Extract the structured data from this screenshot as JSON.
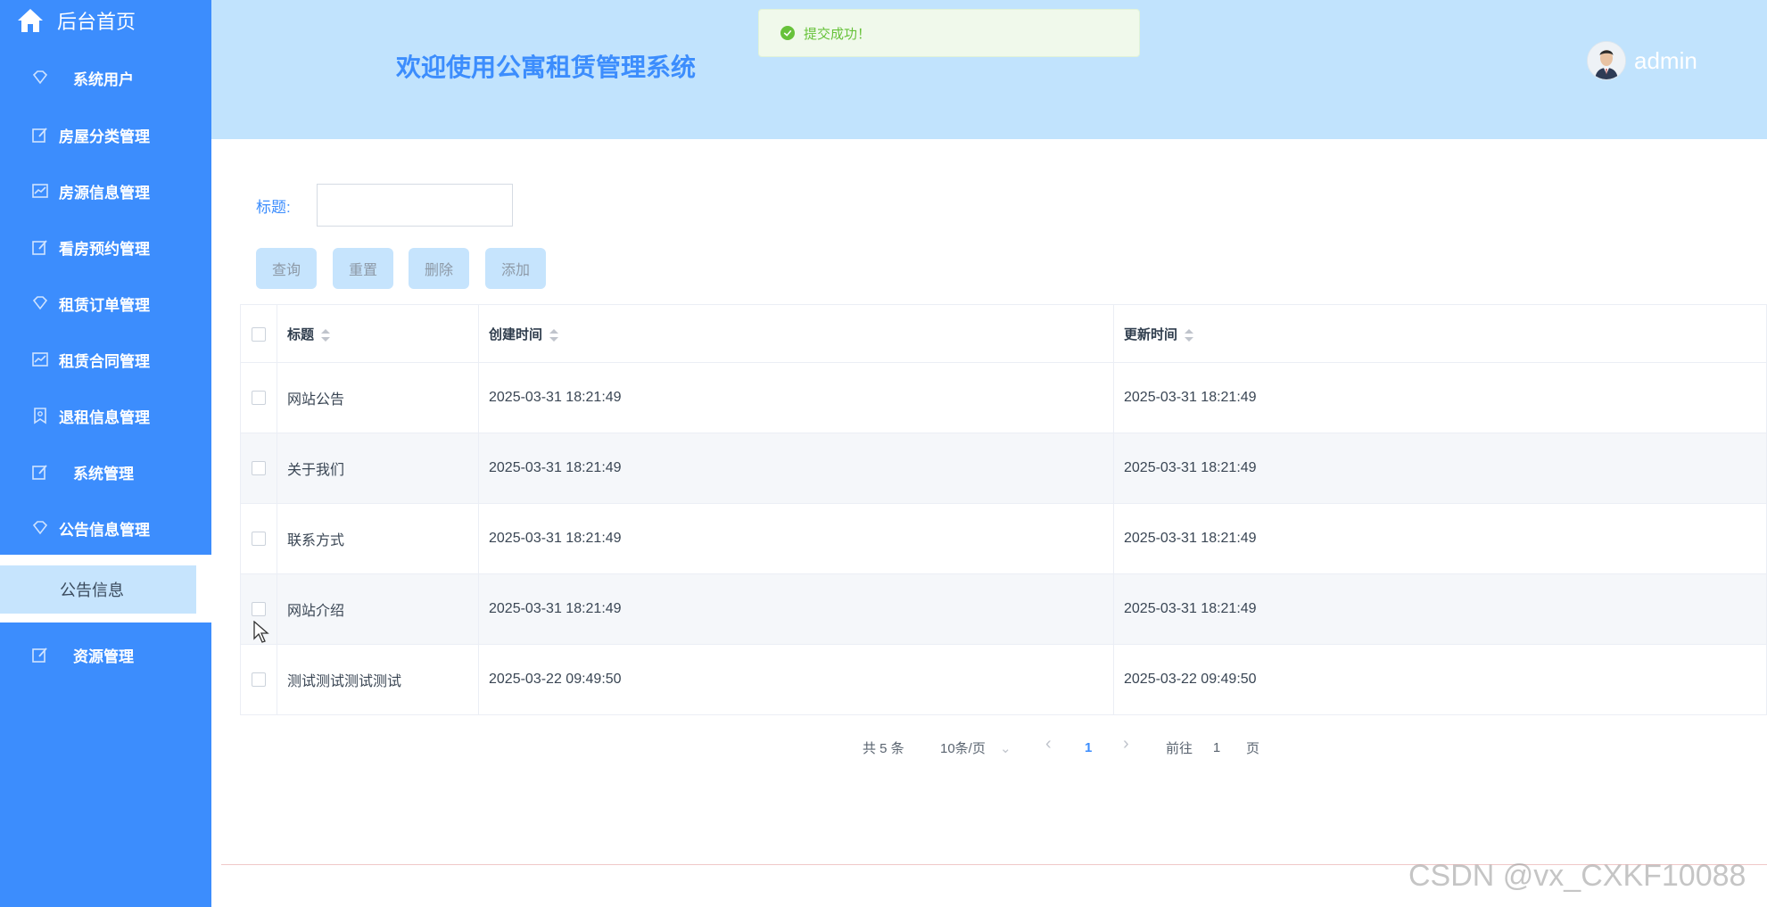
{
  "sidebar": {
    "home_label": "后台首页",
    "items": [
      {
        "label": "系统用户",
        "icon": "diamond-icon"
      },
      {
        "label": "房屋分类管理",
        "icon": "edit-icon"
      },
      {
        "label": "房源信息管理",
        "icon": "chart-icon"
      },
      {
        "label": "看房预约管理",
        "icon": "edit-icon"
      },
      {
        "label": "租赁订单管理",
        "icon": "diamond-icon"
      },
      {
        "label": "租赁合同管理",
        "icon": "chart-icon"
      },
      {
        "label": "退租信息管理",
        "icon": "bookmark-icon"
      },
      {
        "label": "系统管理",
        "icon": "edit-icon"
      },
      {
        "label": "公告信息管理",
        "icon": "diamond-icon"
      },
      {
        "label": "资源管理",
        "icon": "edit-icon"
      }
    ],
    "submenu": {
      "label": "公告信息"
    }
  },
  "header": {
    "title": "欢迎使用公寓租赁管理系统",
    "username": "admin"
  },
  "toast": {
    "message": "提交成功！"
  },
  "search": {
    "label": "标题:",
    "value": ""
  },
  "buttons": {
    "query": "查询",
    "reset": "重置",
    "delete": "删除",
    "add": "添加"
  },
  "table": {
    "columns": [
      "标题",
      "创建时间",
      "更新时间"
    ],
    "rows": [
      {
        "title": "网站公告",
        "created": "2025-03-31 18:21:49",
        "updated": "2025-03-31 18:21:49"
      },
      {
        "title": "关于我们",
        "created": "2025-03-31 18:21:49",
        "updated": "2025-03-31 18:21:49"
      },
      {
        "title": "联系方式",
        "created": "2025-03-31 18:21:49",
        "updated": "2025-03-31 18:21:49"
      },
      {
        "title": "网站介绍",
        "created": "2025-03-31 18:21:49",
        "updated": "2025-03-31 18:21:49"
      },
      {
        "title": "测试测试测试测试",
        "created": "2025-03-22 09:49:50",
        "updated": "2025-03-22 09:49:50"
      }
    ]
  },
  "pagination": {
    "total": "共 5 条",
    "page_size": "10条/页",
    "current_page": "1",
    "goto_prefix": "前往",
    "goto_value": "1",
    "goto_suffix": "页"
  },
  "watermark": "CSDN @vx_CXKF10088",
  "colors": {
    "sidebar_bg": "#3c8dfd",
    "header_bg": "#c1e3fd",
    "accent": "#3c8dfd",
    "success": "#67c23a"
  }
}
